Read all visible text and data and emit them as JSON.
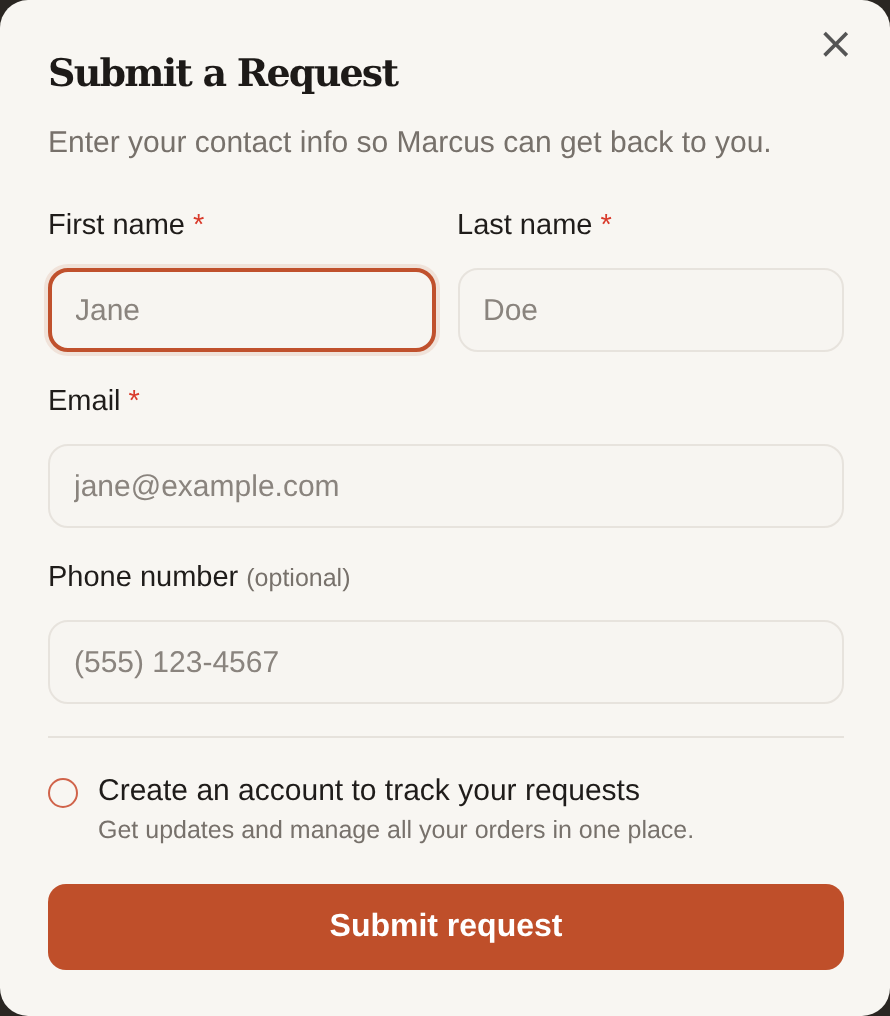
{
  "dialog": {
    "title": "Submit a Request",
    "subtitle": "Enter your contact info so Marcus can get back to you.",
    "close": "×"
  },
  "rows": [
    [
      {
        "label": "First name",
        "required_mark": "*",
        "placeholder": "Jane",
        "focused": true
      },
      {
        "label": "Last name",
        "required_mark": "*",
        "placeholder": "Doe",
        "focused": false
      }
    ],
    [
      {
        "label": "Email",
        "required_mark": "*",
        "placeholder": "jane@example.com",
        "focused": false
      }
    ],
    [
      {
        "label": "Phone number",
        "note": "(optional)",
        "placeholder": "(555) 123-4567",
        "focused": false
      }
    ]
  ],
  "account_option": {
    "label": "Create an account to track your requests",
    "description": "Get updates and manage all your orders in one place.",
    "checked": false
  },
  "submit_button": "Submit request"
}
